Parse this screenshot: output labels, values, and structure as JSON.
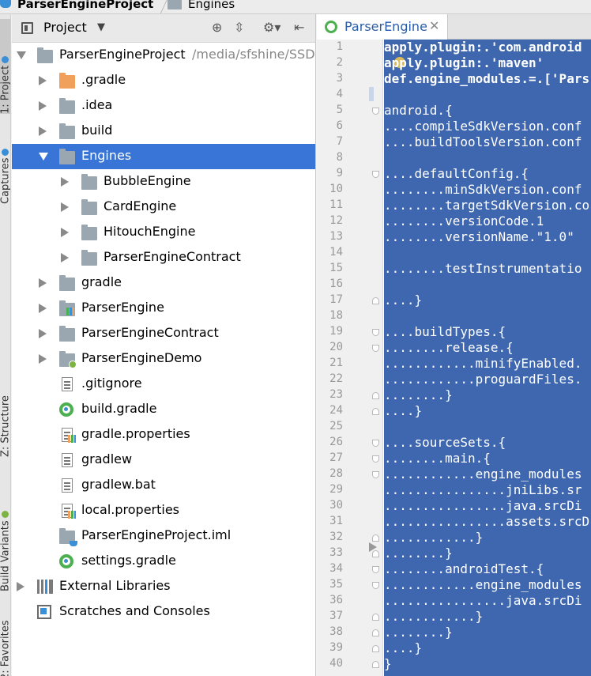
{
  "breadcrumb": {
    "project": "ParserEngineProject",
    "folder": "Engines"
  },
  "left_strip": {
    "tabs": [
      "1: Project",
      "Captures",
      "Z: Structure",
      "Build Variants",
      "2: Favorites"
    ]
  },
  "project_panel": {
    "title": "Project",
    "icons": [
      "crosshair-icon",
      "collapse-icon",
      "gear-icon",
      "hide-icon"
    ],
    "tree": [
      {
        "label": "ParserEngineProject",
        "path": "/media/sfshine/SSDW",
        "type": "project-folder",
        "level": 0,
        "state": "expanded"
      },
      {
        "label": ".gradle",
        "type": "folder-orange",
        "level": 1,
        "state": "collapsed"
      },
      {
        "label": ".idea",
        "type": "folder",
        "level": 1,
        "state": "collapsed"
      },
      {
        "label": "build",
        "type": "folder",
        "level": 1,
        "state": "collapsed"
      },
      {
        "label": "Engines",
        "type": "folder",
        "level": 1,
        "state": "expanded",
        "selected": true
      },
      {
        "label": "BubbleEngine",
        "type": "folder",
        "level": 2,
        "state": "collapsed"
      },
      {
        "label": "CardEngine",
        "type": "folder",
        "level": 2,
        "state": "collapsed"
      },
      {
        "label": "HitouchEngine",
        "type": "folder",
        "level": 2,
        "state": "collapsed"
      },
      {
        "label": "ParserEngineContract",
        "type": "folder",
        "level": 2,
        "state": "collapsed"
      },
      {
        "label": "gradle",
        "type": "folder",
        "level": 1,
        "state": "collapsed"
      },
      {
        "label": "ParserEngine",
        "type": "folder-lib",
        "level": 1,
        "state": "collapsed"
      },
      {
        "label": "ParserEngineContract",
        "type": "folder",
        "level": 1,
        "state": "collapsed"
      },
      {
        "label": "ParserEngineDemo",
        "type": "folder-dot",
        "level": 1,
        "state": "collapsed"
      },
      {
        "label": ".gitignore",
        "type": "file",
        "level": 1,
        "state": "none"
      },
      {
        "label": "build.gradle",
        "type": "gradle",
        "level": 1,
        "state": "none"
      },
      {
        "label": "gradle.properties",
        "type": "props",
        "level": 1,
        "state": "none"
      },
      {
        "label": "gradlew",
        "type": "file",
        "level": 1,
        "state": "none"
      },
      {
        "label": "gradlew.bat",
        "type": "file",
        "level": 1,
        "state": "none"
      },
      {
        "label": "local.properties",
        "type": "props",
        "level": 1,
        "state": "none"
      },
      {
        "label": "ParserEngineProject.iml",
        "type": "folder-cup",
        "level": 1,
        "state": "none"
      },
      {
        "label": "settings.gradle",
        "type": "gradle",
        "level": 1,
        "state": "none"
      },
      {
        "label": "External Libraries",
        "type": "libs",
        "level": 0,
        "state": "collapsed"
      },
      {
        "label": "Scratches and Consoles",
        "type": "scratch",
        "level": 0,
        "state": "none"
      }
    ]
  },
  "editor": {
    "tab_label": "ParserEngine",
    "tab_close": "✕",
    "lines": [
      "apply.plugin:.'com.android",
      "apply.plugin:.'maven'",
      "def.engine_modules.=.['Pars",
      "",
      "android.{",
      "....compileSdkVersion.conf",
      "....buildToolsVersion.conf",
      "",
      "....defaultConfig.{",
      "........minSdkVersion.conf",
      "........targetSdkVersion.co",
      "........versionCode.1",
      "........versionName.\"1.0\"",
      "",
      "........testInstrumentatio",
      "",
      "....}",
      "",
      "....buildTypes.{",
      "........release.{",
      "............minifyEnabled.",
      "............proguardFiles.",
      "........}",
      "....}",
      "",
      "....sourceSets.{",
      "........main.{",
      "............engine_modules",
      "................jniLibs.sr",
      "................java.srcDi",
      "................assets.srcD",
      "............}",
      "........}",
      "........androidTest.{",
      "............engine_modules",
      "................java.srcDi",
      "............}",
      "........}",
      "....}",
      "}"
    ]
  }
}
